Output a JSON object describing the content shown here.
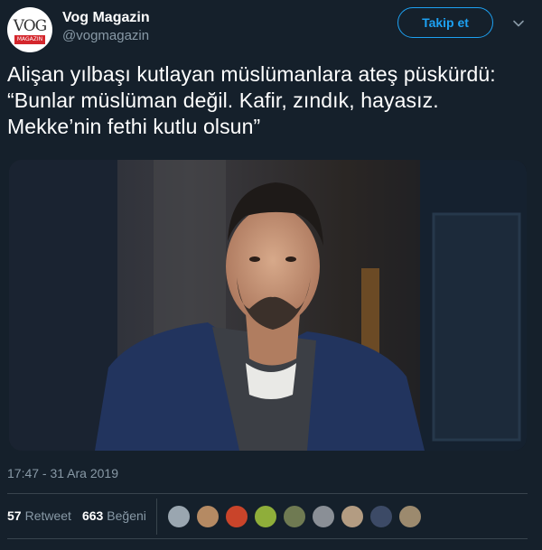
{
  "account": {
    "display_name": "Vog Magazin",
    "handle": "@vogmagazin",
    "avatar_logo": "VOG",
    "avatar_logo_sub": "MAGAZIN"
  },
  "follow_label": "Takip et",
  "tweet": {
    "text": "Alişan yılbaşı kutlayan müslümanlara ateş püskürdü: “Bunlar müslüman değil. Kafir, zındık, hayasız. Mekke’nin fethi kutlu olsun”"
  },
  "photo": {
    "icon": "photo-of-man-in-blue-jacket"
  },
  "timestamp": "17:47 - 31 Ara 2019",
  "stats": {
    "retweet_count": "57",
    "retweet_label": "Retweet",
    "like_count": "663",
    "like_label": "Beğeni"
  },
  "likers": [
    {
      "color": "#9aa6b0"
    },
    {
      "color": "#b58a63"
    },
    {
      "color": "#c9442a"
    },
    {
      "color": "#8fae3a"
    },
    {
      "color": "#6f7a52"
    },
    {
      "color": "#8a8f96"
    },
    {
      "color": "#b39c82"
    },
    {
      "color": "#3c4a66"
    },
    {
      "color": "#9c8a6e"
    }
  ],
  "colors": {
    "background": "#15202b",
    "accent": "#1da1f2",
    "secondary_text": "#8899a6",
    "divider": "#38444d"
  }
}
